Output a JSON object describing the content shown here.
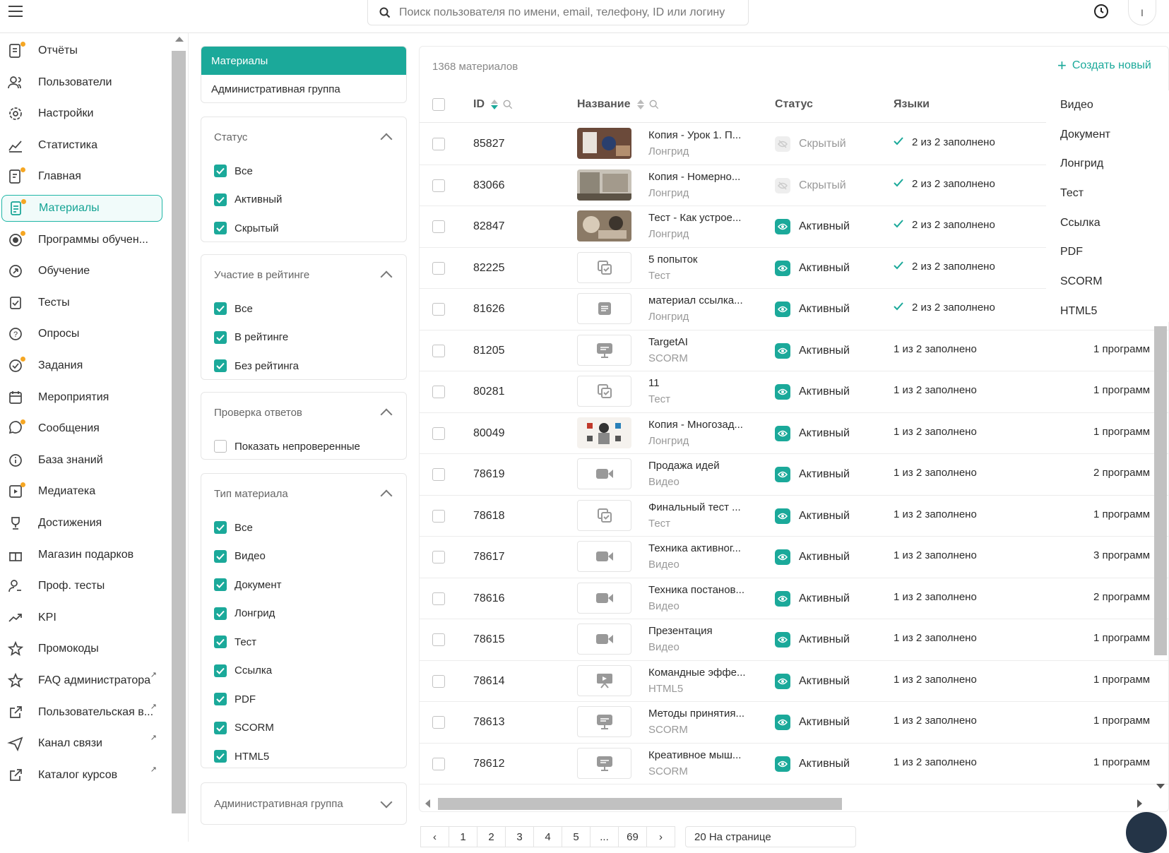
{
  "search": {
    "placeholder": "Поиск пользователя по имени, email, телефону, ID или логину"
  },
  "user_avatar": "I",
  "sidebar": {
    "items": [
      {
        "label": "Отчёты",
        "icon": "reports-icon"
      },
      {
        "label": "Пользователи",
        "icon": "users-icon"
      },
      {
        "label": "Настройки",
        "icon": "gear-icon"
      },
      {
        "label": "Статистика",
        "icon": "chart-icon"
      },
      {
        "label": "Главная",
        "icon": "home-icon"
      },
      {
        "label": "Материалы",
        "icon": "materials-icon",
        "active": true
      },
      {
        "label": "Программы обучен...",
        "icon": "programs-icon"
      },
      {
        "label": "Обучение",
        "icon": "learning-icon"
      },
      {
        "label": "Тесты",
        "icon": "tests-icon"
      },
      {
        "label": "Опросы",
        "icon": "surveys-icon"
      },
      {
        "label": "Задания",
        "icon": "tasks-icon"
      },
      {
        "label": "Мероприятия",
        "icon": "calendar-icon"
      },
      {
        "label": "Сообщения",
        "icon": "messages-icon"
      },
      {
        "label": "База знаний",
        "icon": "info-icon"
      },
      {
        "label": "Медиатека",
        "icon": "media-icon"
      },
      {
        "label": "Достижения",
        "icon": "trophy-icon"
      },
      {
        "label": "Магазин подарков",
        "icon": "gift-icon"
      },
      {
        "label": "Проф. тесты",
        "icon": "prof-tests-icon"
      },
      {
        "label": "KPI",
        "icon": "trend-icon"
      },
      {
        "label": "Промокоды",
        "icon": "star-icon"
      },
      {
        "label": "FAQ администратора",
        "icon": "star-icon",
        "external": true
      },
      {
        "label": "Пользовательская в...",
        "icon": "external-link-icon",
        "external": true
      },
      {
        "label": "Канал связи",
        "icon": "send-icon",
        "external": true
      },
      {
        "label": "Каталог курсов",
        "icon": "external-link-icon",
        "external": true
      }
    ]
  },
  "tabs": [
    "Материалы",
    "Административная группа"
  ],
  "filters": {
    "status": {
      "title": "Статус",
      "options": [
        "Все",
        "Активный",
        "Скрытый"
      ]
    },
    "rating": {
      "title": "Участие в рейтинге",
      "options": [
        "Все",
        "В рейтинге",
        "Без рейтинга"
      ]
    },
    "check": {
      "title": "Проверка ответов",
      "options": [
        "Показать непроверенные"
      ]
    },
    "type": {
      "title": "Тип материала",
      "options": [
        "Все",
        "Видео",
        "Документ",
        "Лонгрид",
        "Тест",
        "Ссылка",
        "PDF",
        "SCORM",
        "HTML5"
      ]
    },
    "admin_group": {
      "title": "Административная группа"
    }
  },
  "list": {
    "count": "1368 материалов",
    "create_label": "Создать новый",
    "columns": [
      "ID",
      "Название",
      "Статус",
      "Языки"
    ],
    "rows": [
      {
        "id": "85827",
        "title": "Копия - Урок 1. П...",
        "type": "Лонгрид",
        "status": "Скрытый",
        "langs": "2 из 2 заполнено",
        "lang_full": true,
        "prog": "",
        "thumb": "photo1"
      },
      {
        "id": "83066",
        "title": "Копия - Номерно...",
        "type": "Лонгрид",
        "status": "Скрытый",
        "langs": "2 из 2 заполнено",
        "lang_full": true,
        "prog": "",
        "thumb": "photo2"
      },
      {
        "id": "82847",
        "title": "Тест - Как устрое...",
        "type": "Лонгрид",
        "status": "Активный",
        "langs": "2 из 2 заполнено",
        "lang_full": true,
        "prog": "",
        "thumb": "photo3"
      },
      {
        "id": "82225",
        "title": "5 попыток",
        "type": "Тест",
        "status": "Активный",
        "langs": "2 из 2 заполнено",
        "lang_full": true,
        "prog": "",
        "thumb": "test"
      },
      {
        "id": "81626",
        "title": "материал ссылка...",
        "type": "Лонгрид",
        "status": "Активный",
        "langs": "2 из 2 заполнено",
        "lang_full": true,
        "prog": "",
        "thumb": "doc"
      },
      {
        "id": "81205",
        "title": "TargetAI",
        "type": "SCORM",
        "status": "Активный",
        "langs": "1 из 2 заполнено",
        "lang_full": false,
        "prog": "1 программ",
        "thumb": "scorm"
      },
      {
        "id": "80281",
        "title": "11",
        "type": "Тест",
        "status": "Активный",
        "langs": "1 из 2 заполнено",
        "lang_full": false,
        "prog": "1 программ",
        "thumb": "test"
      },
      {
        "id": "80049",
        "title": "Копия - Многозад...",
        "type": "Лонгрид",
        "status": "Активный",
        "langs": "1 из 2 заполнено",
        "lang_full": false,
        "prog": "1 программ",
        "thumb": "photo4"
      },
      {
        "id": "78619",
        "title": "Продажа идей",
        "type": "Видео",
        "status": "Активный",
        "langs": "1 из 2 заполнено",
        "lang_full": false,
        "prog": "2 программ",
        "thumb": "video"
      },
      {
        "id": "78618",
        "title": "Финальный тест ...",
        "type": "Тест",
        "status": "Активный",
        "langs": "1 из 2 заполнено",
        "lang_full": false,
        "prog": "1 программ",
        "thumb": "test"
      },
      {
        "id": "78617",
        "title": "Техника активног...",
        "type": "Видео",
        "status": "Активный",
        "langs": "1 из 2 заполнено",
        "lang_full": false,
        "prog": "3 программ",
        "thumb": "video"
      },
      {
        "id": "78616",
        "title": "Техника постанов...",
        "type": "Видео",
        "status": "Активный",
        "langs": "1 из 2 заполнено",
        "lang_full": false,
        "prog": "2 программ",
        "thumb": "video"
      },
      {
        "id": "78615",
        "title": "Презентация",
        "type": "Видео",
        "status": "Активный",
        "langs": "1 из 2 заполнено",
        "lang_full": false,
        "prog": "1 программ",
        "thumb": "video"
      },
      {
        "id": "78614",
        "title": "Командные эффе...",
        "type": "HTML5",
        "status": "Активный",
        "langs": "1 из 2 заполнено",
        "lang_full": false,
        "prog": "1 программ",
        "thumb": "html5"
      },
      {
        "id": "78613",
        "title": "Методы принятия...",
        "type": "SCORM",
        "status": "Активный",
        "langs": "1 из 2 заполнено",
        "lang_full": false,
        "prog": "1 программ",
        "thumb": "scorm"
      },
      {
        "id": "78612",
        "title": "Креативное мыш...",
        "type": "SCORM",
        "status": "Активный",
        "langs": "1 из 2 заполнено",
        "lang_full": false,
        "prog": "1 программ",
        "thumb": "scorm"
      }
    ]
  },
  "create_menu": [
    "Видео",
    "Документ",
    "Лонгрид",
    "Тест",
    "Ссылка",
    "PDF",
    "SCORM",
    "HTML5"
  ],
  "pagination": {
    "pages": [
      "1",
      "2",
      "3",
      "4",
      "5",
      "...",
      "69"
    ],
    "per_page": "20 На странице"
  },
  "colors": {
    "accent": "#1ba99a",
    "brand_dot": "#f5a623"
  }
}
